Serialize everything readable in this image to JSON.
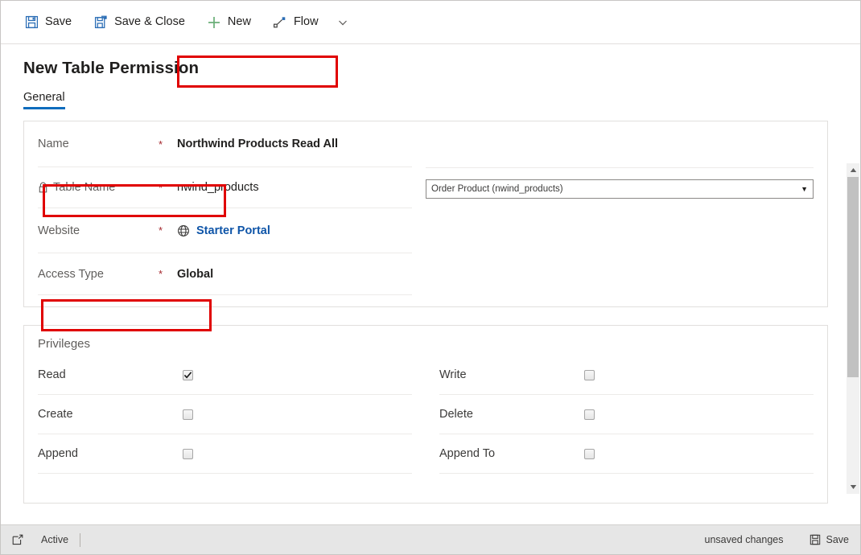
{
  "commandbar": {
    "items": [
      {
        "icon": "save-icon",
        "label": "Save"
      },
      {
        "icon": "save-and-close-icon",
        "label": "Save & Close"
      },
      {
        "icon": "new-plus-icon",
        "label": "New"
      },
      {
        "icon": "flow-icon",
        "label": "Flow"
      }
    ],
    "overflow_icon": "chevron-down-icon"
  },
  "page": {
    "title": "New Table Permission"
  },
  "tabs": [
    {
      "label": "General",
      "active": true
    }
  ],
  "general": {
    "rows": [
      {
        "label": "Name",
        "required": "*",
        "value": "Northwind Products Read All",
        "locked": false,
        "highlighted": true
      },
      {
        "label": "Table Name",
        "required": "*",
        "value": "nwind_products",
        "locked": true,
        "lock_icon": "lock-icon",
        "highlighted": false
      },
      {
        "label": "Website",
        "required": "*",
        "value": "Starter Portal",
        "is_link": true,
        "icon": "globe-icon",
        "highlighted": false
      },
      {
        "label": "Access Type",
        "required": "*",
        "value": "Global",
        "bold": true,
        "highlighted": true
      }
    ],
    "table_dropdown": {
      "value": "Order Product (nwind_products)",
      "caret_icon": "caret-down-icon"
    }
  },
  "privileges": {
    "section_title": "Privileges",
    "left": [
      {
        "label": "Read",
        "checked": true,
        "highlighted": true
      },
      {
        "label": "Create",
        "checked": false,
        "highlighted": false
      },
      {
        "label": "Append",
        "checked": false,
        "highlighted": false
      }
    ],
    "right": [
      {
        "label": "Write",
        "checked": false,
        "highlighted": false
      },
      {
        "label": "Delete",
        "checked": false,
        "highlighted": false
      },
      {
        "label": "Append To",
        "checked": false,
        "highlighted": false
      }
    ]
  },
  "scrollbar": {
    "up_icon": "scroll-up-arrow-icon",
    "down_icon": "scroll-down-arrow-icon",
    "thumb_fraction": "66%"
  },
  "statusbar": {
    "popout_icon": "open-in-new-window-icon",
    "state": "Active",
    "unsaved": "unsaved changes",
    "save_icon": "save-icon",
    "save_label": "Save"
  },
  "colors": {
    "accent_blue": "#0f6cbd",
    "link_blue": "#0f55a8",
    "required_red": "#a4262c",
    "annotation_red": "#e00000",
    "new_green": "#69af77",
    "statusbar_bg": "#e6e6e6"
  }
}
